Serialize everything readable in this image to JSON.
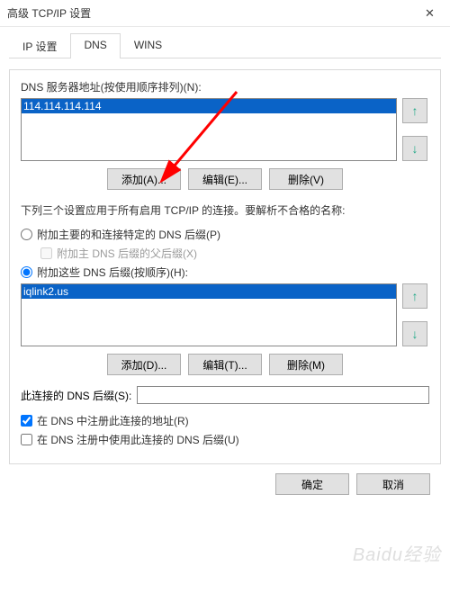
{
  "window": {
    "title": "高级 TCP/IP 设置",
    "close_glyph": "✕"
  },
  "tabs": {
    "ip": "IP 设置",
    "dns": "DNS",
    "wins": "WINS"
  },
  "dns_servers": {
    "label": "DNS 服务器地址(按使用顺序排列)(N):",
    "items": [
      "114.114.114.114"
    ],
    "add": "添加(A)...",
    "edit": "编辑(E)...",
    "remove": "删除(V)"
  },
  "note": "下列三个设置应用于所有启用 TCP/IP 的连接。要解析不合格的名称:",
  "radio_primary": "附加主要的和连接特定的 DNS 后缀(P)",
  "check_parent": "附加主 DNS 后缀的父后缀(X)",
  "radio_these": "附加这些 DNS 后缀(按顺序)(H):",
  "suffixes": {
    "items": [
      "iqlink2.us"
    ],
    "add": "添加(D)...",
    "edit": "编辑(T)...",
    "remove": "删除(M)"
  },
  "suffix_field": {
    "label": "此连接的 DNS 后缀(S):",
    "value": ""
  },
  "check_register": "在 DNS 中注册此连接的地址(R)",
  "check_use_suffix": "在 DNS 注册中使用此连接的 DNS 后缀(U)",
  "footer": {
    "ok": "确定",
    "cancel": "取消"
  },
  "arrows": {
    "up": "↑",
    "down": "↓"
  },
  "watermark": "Baidu经验"
}
